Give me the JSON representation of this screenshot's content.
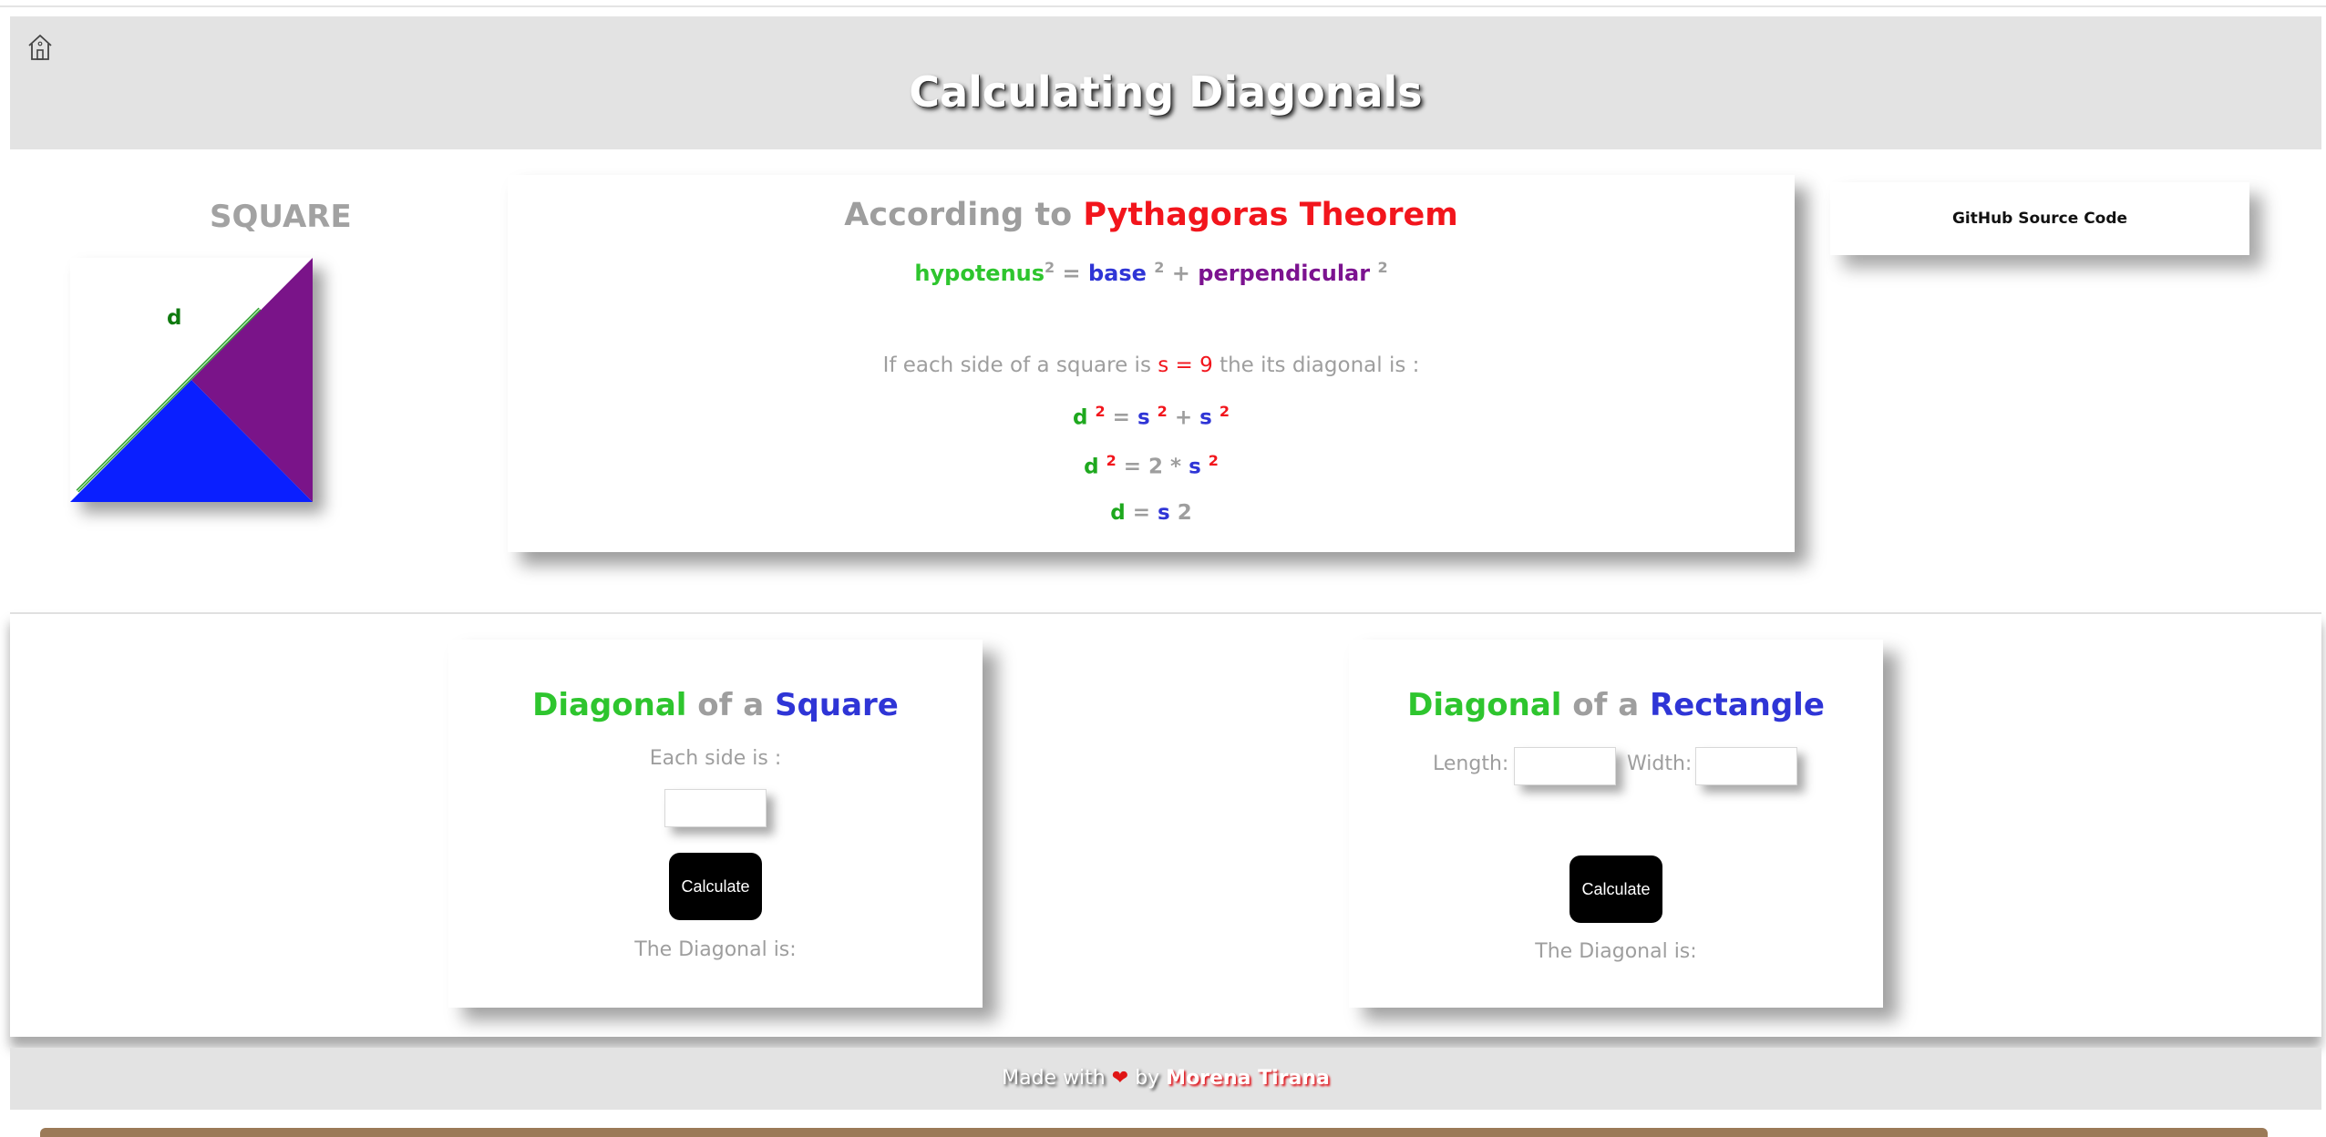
{
  "header": {
    "title": "Calculating Diagonals",
    "home_icon": "home-icon"
  },
  "figure": {
    "shape_title": "SQUARE",
    "diagonal_label": "d",
    "colors": {
      "lower_triangle": "#0a1fff",
      "upper_triangle": "#7a1489",
      "diagonal_line": "#2f9e2f"
    }
  },
  "theorem": {
    "title_prefix": "According to",
    "title_highlight": "Pythagoras Theorem",
    "formula": {
      "hyp": "hypotenus",
      "hyp_exp": "2",
      "eq": "=",
      "base": "base",
      "base_exp": "2",
      "plus": "+",
      "perp": "perpendicular",
      "perp_exp": "2"
    },
    "text": {
      "before": "If each side of a square is",
      "s_eq": "s = 9",
      "after": "the its diagonal is :"
    },
    "eq1": {
      "d": "d",
      "d_exp": "2",
      "eq": "=",
      "s1": "s",
      "s1_exp": "2",
      "plus": "+",
      "s2": "s",
      "s2_exp": "2"
    },
    "eq2": {
      "d": "d",
      "d_exp": "2",
      "eq": "= 2 *",
      "s": "s",
      "s_exp": "2"
    },
    "eq3": {
      "d": "d",
      "eq": "=",
      "s": "s",
      "two": "2"
    }
  },
  "github": {
    "label": "GitHub Source Code"
  },
  "square_calc": {
    "title_diagonal": "Diagonal",
    "title_ofa": "of a",
    "title_shape": "Square",
    "side_label": "Each side is :",
    "side_value": "",
    "button": "Calculate",
    "result_label": "The Diagonal is:"
  },
  "rect_calc": {
    "title_diagonal": "Diagonal",
    "title_ofa": "of a",
    "title_shape": "Rectangle",
    "length_label": "Length:",
    "length_value": "",
    "width_label": "Width:",
    "width_value": "",
    "button": "Calculate",
    "result_label": "The Diagonal is:"
  },
  "footer": {
    "made_with": "Made with",
    "heart": "❤",
    "by": "by",
    "author": "Morena Tirana"
  }
}
